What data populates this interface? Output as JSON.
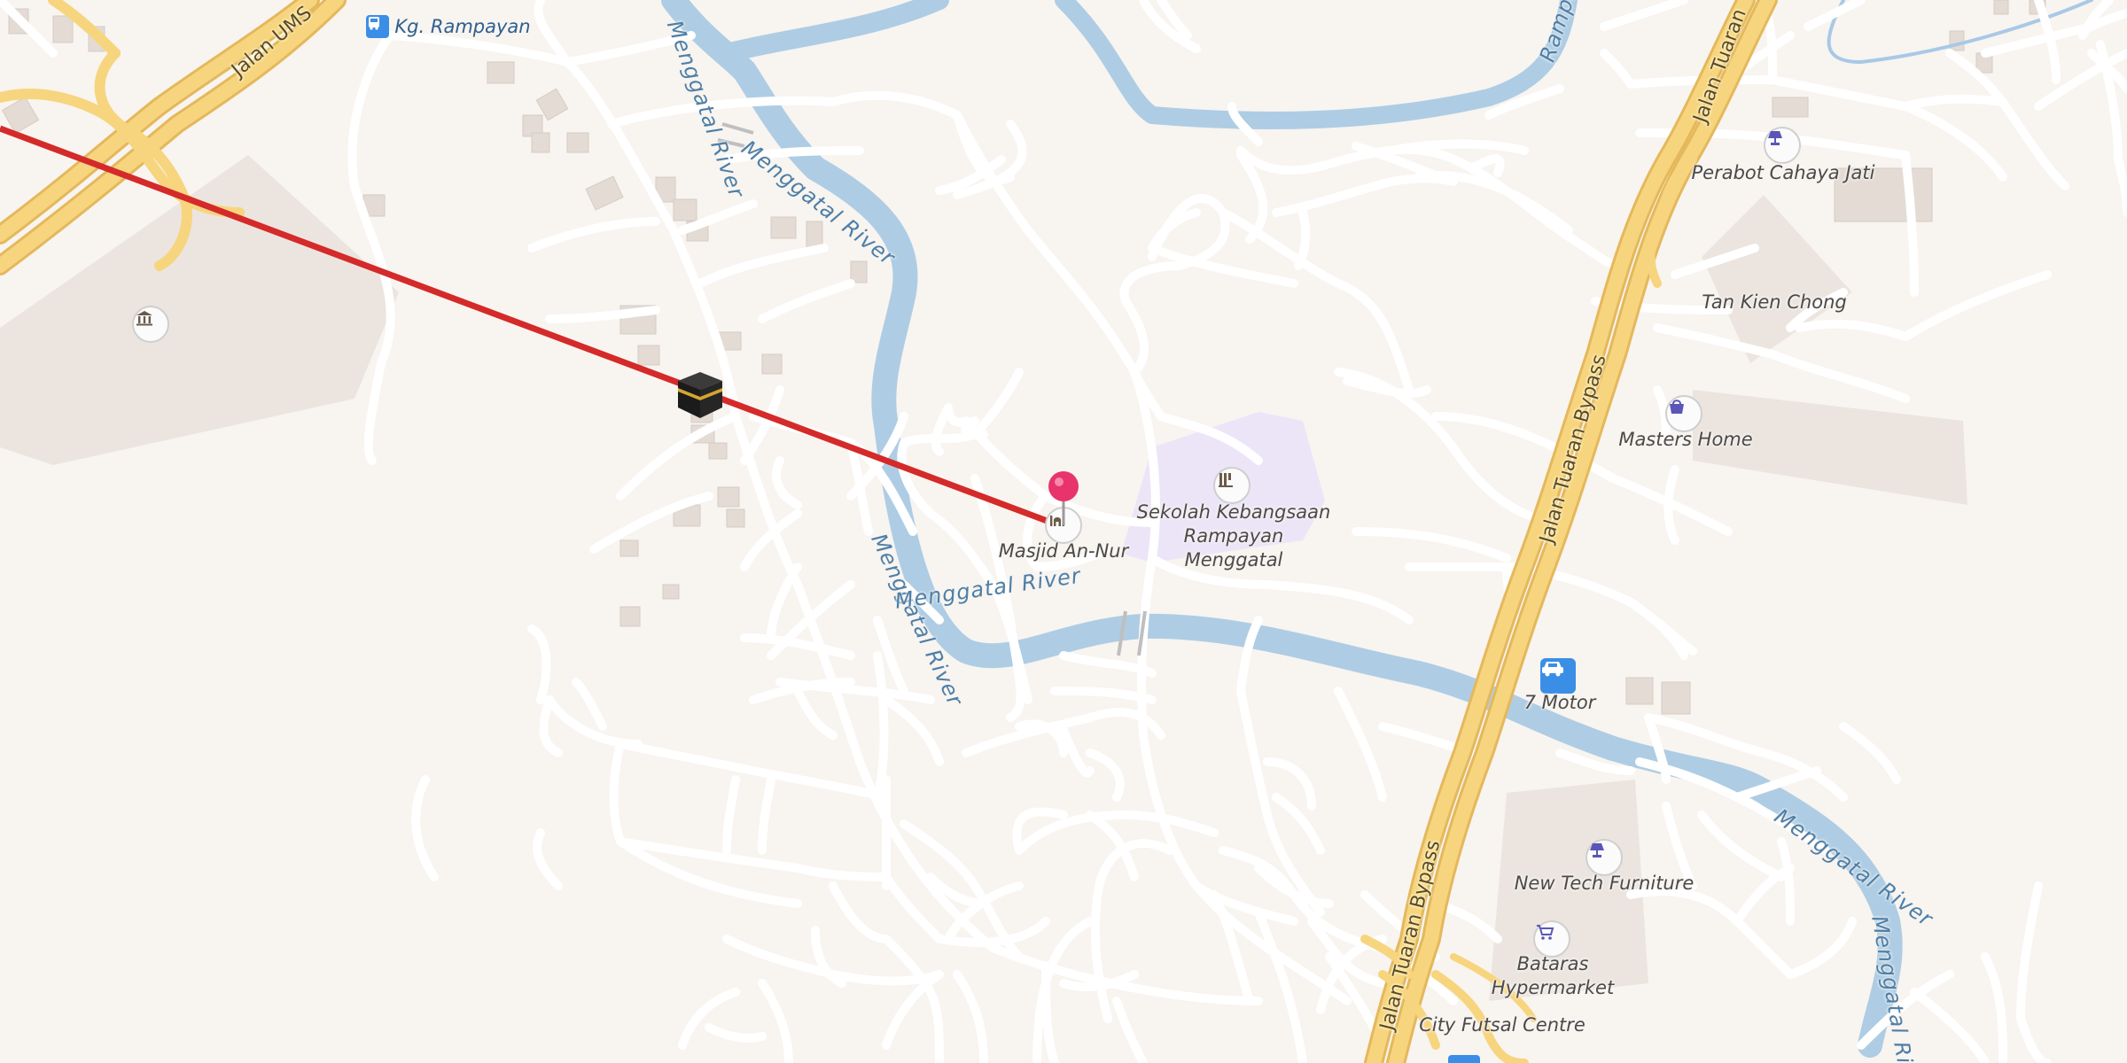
{
  "map": {
    "places": {
      "bus_stop": "Kg. Rampayan",
      "mosque": "Masjid An-Nur",
      "school": [
        "Sekolah Kebangsaan",
        "Rampayan",
        "Menggatal"
      ],
      "perabot": "Perabot Cahaya Jati",
      "tan_kien": "Tan Kien Chong",
      "masters": "Masters Home",
      "motor": "7 Motor",
      "newtech": "New Tech Furniture",
      "bataras": [
        "Bataras",
        "Hypermarket"
      ],
      "futsal": "City Futsal Centre"
    },
    "rivers": {
      "r1": "Menggatal River",
      "r2": "Menggatal River",
      "r3": "Menggatal River",
      "r4": "Menggatal River",
      "r5": "Rampay"
    },
    "roads": {
      "ums": "Jalan UMS",
      "tuaran_top": "Jalan Tuaran",
      "bypass_mid": "Jalan Tuaran Bypass",
      "bypass_bottom": "Jalan Tuaran Bypass"
    },
    "icons": {
      "bus": "bus-stop-icon",
      "museum": "museum-icon",
      "mosque": "mosque-icon",
      "school": "school-icon",
      "furniture": "lamp-icon",
      "shop": "shopping-bag-icon",
      "car": "car-icon",
      "cart": "shopping-cart-icon",
      "kaaba": "kaaba-icon",
      "pin": "location-pin-icon"
    },
    "colors": {
      "background": "#f8f4f0",
      "road": "#ffffff",
      "highway": "#f7d57e",
      "river": "#aecde4",
      "qibla_line": "#d42a2a",
      "pin": "#e8336d",
      "school_area": "#ece5f8",
      "poi_icon": "#5b55b8"
    }
  }
}
